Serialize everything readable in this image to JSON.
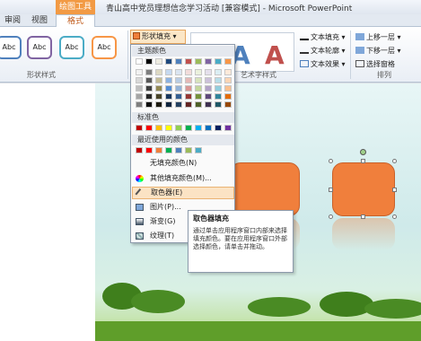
{
  "titlebar": {
    "tool_tag": "绘图工具",
    "title": "青山高中党员理想信念学习活动 [兼容模式] - Microsoft PowerPoint"
  },
  "tabs": [
    {
      "label": "审阅"
    },
    {
      "label": "视图"
    },
    {
      "label": "格式",
      "active": true
    }
  ],
  "ribbon": {
    "shape_styles": {
      "sample_label": "Abc",
      "group_label": "形状样式",
      "styles": [
        {
          "border_color": "#4f81bd"
        },
        {
          "border_color": "#8064a2"
        },
        {
          "border_color": "#4bacc6"
        },
        {
          "border_color": "#f79646"
        }
      ]
    },
    "shape_fill_label": "形状填充",
    "wordart": {
      "group_label": "艺术字样式",
      "samples": [
        {
          "letter": "A",
          "color": "#e8eef6",
          "stroke": "#8aa6c8"
        },
        {
          "letter": "A",
          "color": "#4f81bd"
        },
        {
          "letter": "A",
          "color": "#c0504d"
        }
      ],
      "text_fill_label": "文本填充",
      "text_outline_label": "文本轮廓",
      "text_effects_label": "文本效果"
    },
    "arrange": {
      "group_label": "排列",
      "bring_forward_label": "上移一层",
      "send_backward_label": "下移一层",
      "selection_pane_label": "选择窗格"
    }
  },
  "menu": {
    "theme_colors_header": "主题颜色",
    "standard_colors_header": "标准色",
    "recent_colors_header": "最近使用的颜色",
    "theme_top_row": [
      "#ffffff",
      "#000000",
      "#eeece1",
      "#1f497d",
      "#4f81bd",
      "#c0504d",
      "#9bbb59",
      "#8064a2",
      "#4bacc6",
      "#f79646"
    ],
    "theme_shades": [
      [
        "#f2f2f2",
        "#7f7f7f",
        "#ddd9c3",
        "#c6d9f0",
        "#dbe5f1",
        "#f2dcdb",
        "#ebf1dd",
        "#e5e0ec",
        "#dbeef3",
        "#fdeada"
      ],
      [
        "#d8d8d8",
        "#595959",
        "#c4bd97",
        "#8db3e2",
        "#b8cce4",
        "#e5b9b7",
        "#d7e3bc",
        "#ccc1d9",
        "#b7dde8",
        "#fbd5b5"
      ],
      [
        "#bfbfbf",
        "#3f3f3f",
        "#938953",
        "#548dd4",
        "#95b3d7",
        "#d99694",
        "#c3d69b",
        "#b2a2c7",
        "#92cddc",
        "#fac08f"
      ],
      [
        "#a5a5a5",
        "#262626",
        "#494429",
        "#17365d",
        "#366092",
        "#953734",
        "#76923c",
        "#5f497a",
        "#31859b",
        "#e36c09"
      ],
      [
        "#7f7f7f",
        "#0c0c0c",
        "#1d1b10",
        "#0f243e",
        "#244061",
        "#632423",
        "#4f6128",
        "#3f3151",
        "#205867",
        "#974806"
      ]
    ],
    "standard_colors": [
      "#c00000",
      "#ff0000",
      "#ffc000",
      "#ffff00",
      "#92d050",
      "#00b050",
      "#00b0f0",
      "#0070c0",
      "#002060",
      "#7030a0"
    ],
    "recent_colors": [
      "#c00000",
      "#ff0000",
      "#f07f3c",
      "#00b050",
      "#4f81bd",
      "#9bbb59",
      "#4bacc6"
    ],
    "items": {
      "no_fill": "无填充颜色(N)",
      "more_colors": "其他填充颜色(M)...",
      "eyedropper": "取色器(E)",
      "picture": "图片(P)...",
      "gradient": "渐变(G)",
      "texture": "纹理(T)"
    }
  },
  "tooltip": {
    "title": "取色器填充",
    "body": "通过单击应用程序窗口内部来选择填充颜色。要在应用程序窗口外部选择颜色，请单击并拖动。"
  },
  "slide": {
    "shape_color": "#f07f3c"
  }
}
